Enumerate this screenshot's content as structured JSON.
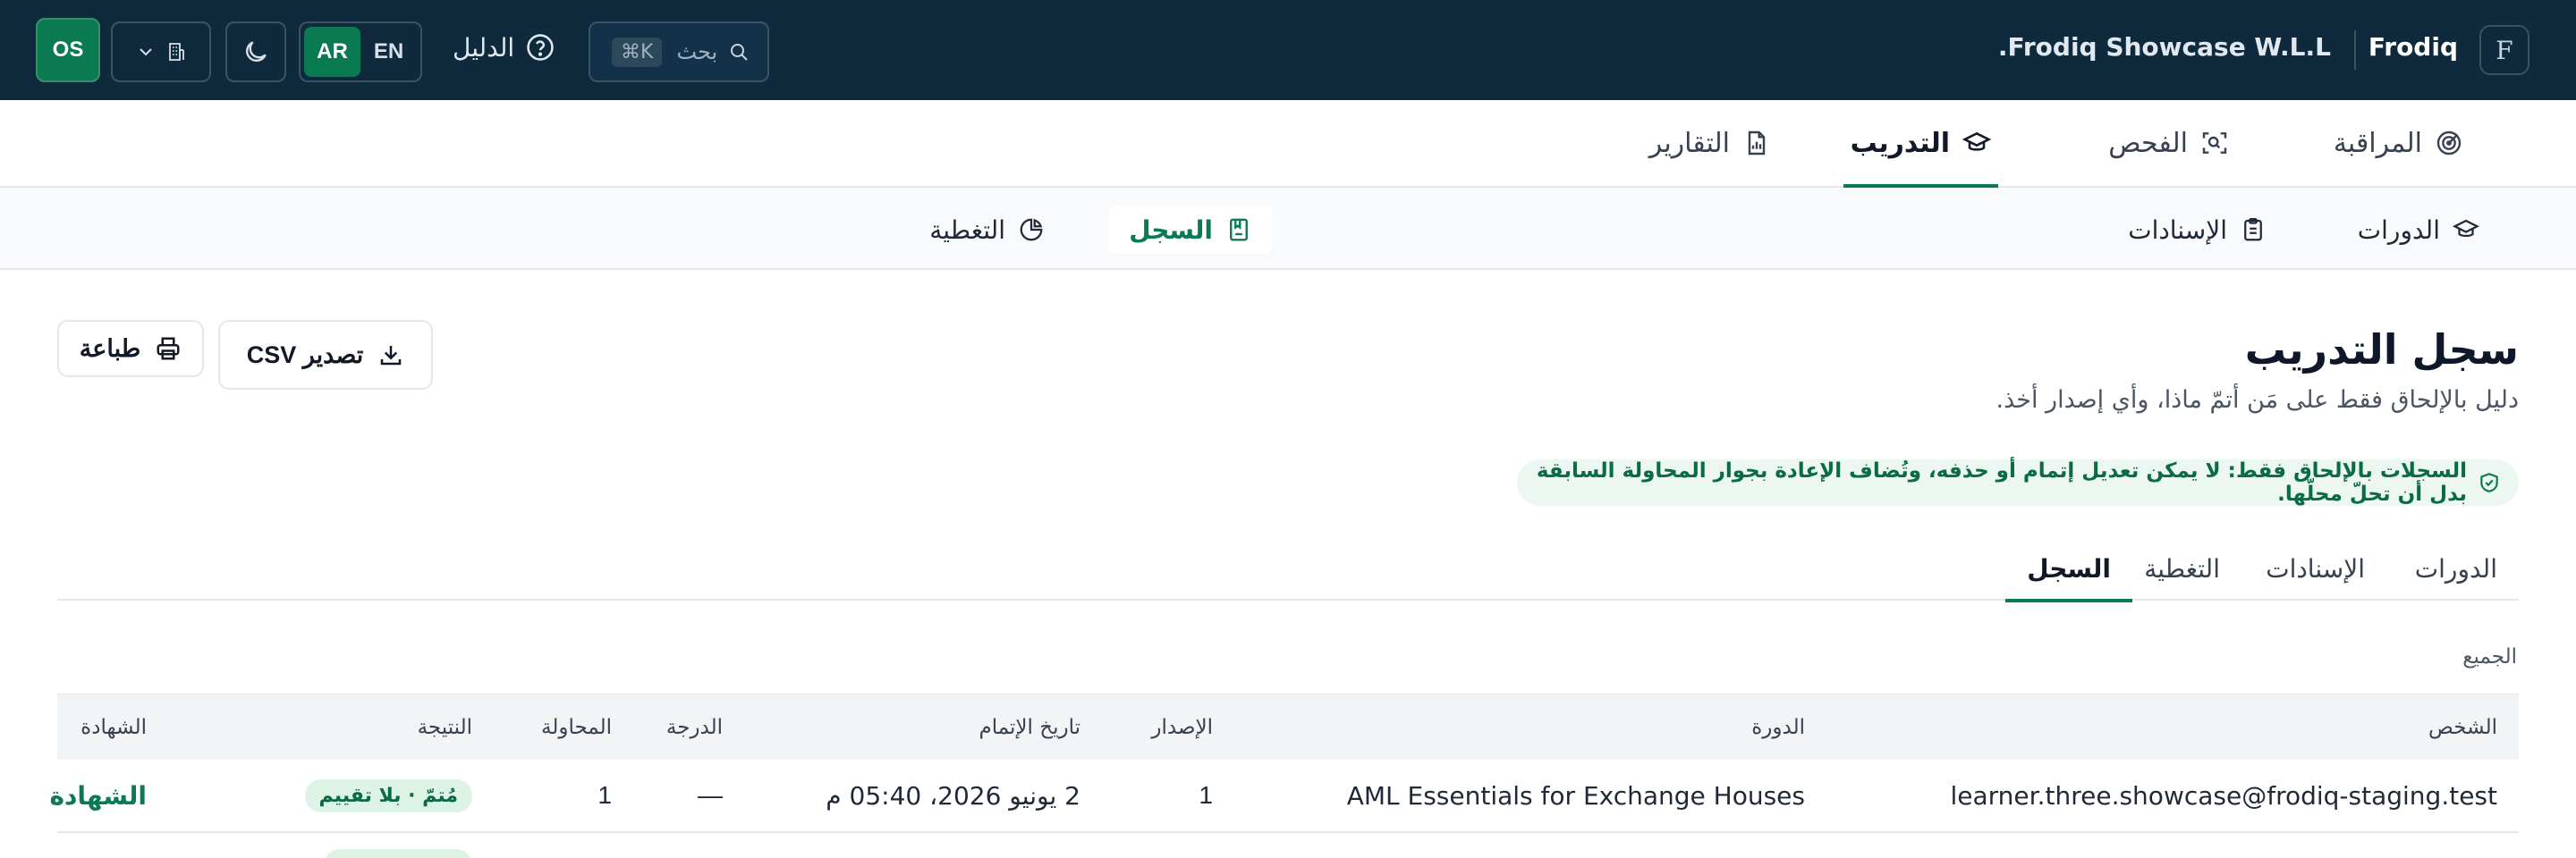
{
  "topbar": {
    "brand_letter": "F",
    "brand_name": "Frodiq",
    "org_name": "Frodiq Showcase W.L.L.",
    "search_placeholder": "بحث",
    "search_shortcut": "⌘K",
    "guide_label": "الدليل",
    "lang_ar": "AR",
    "lang_en": "EN",
    "avatar_initials": "OS"
  },
  "main_nav": [
    {
      "label": "المراقبة",
      "icon": "radar-icon"
    },
    {
      "label": "الفحص",
      "icon": "scan-icon"
    },
    {
      "label": "التدريب",
      "icon": "graduation-cap-icon",
      "active": true
    },
    {
      "label": "التقارير",
      "icon": "report-icon"
    }
  ],
  "sub_nav": [
    {
      "label": "الدورات",
      "icon": "graduation-cap-icon"
    },
    {
      "label": "الإسنادات",
      "icon": "clipboard-icon"
    },
    {
      "label": "السجل",
      "icon": "record-book-icon",
      "active": true
    },
    {
      "label": "التغطية",
      "icon": "pie-chart-icon"
    }
  ],
  "page": {
    "title": "سجل التدريب",
    "subtitle": "دليل بالإلحاق فقط على مَن أتمّ ماذا، وأي إصدار أخذ.",
    "export_button": "تصدير CSV",
    "print_button": "طباعة",
    "notice": "السجلات بالإلحاق فقط: لا يمكن تعديل إتمام أو حذفه، وتُضاف الإعادة بجوار المحاولة السابقة بدل أن تحلّ محلّها."
  },
  "content_tabs": [
    {
      "label": "الدورات"
    },
    {
      "label": "الإسنادات"
    },
    {
      "label": "التغطية"
    },
    {
      "label": "السجل",
      "active": true
    }
  ],
  "filter_label": "الجميع",
  "table": {
    "columns": {
      "person": "الشخص",
      "course": "الدورة",
      "version": "الإصدار",
      "completed_at": "تاريخ الإتمام",
      "score": "الدرجة",
      "attempt": "المحاولة",
      "result": "النتيجة",
      "certificate": "الشهادة"
    },
    "rows": [
      {
        "person": "learner.three.showcase@frodiq-staging.test",
        "course": "AML Essentials for Exchange Houses",
        "version": "1",
        "completed_at": "2 يونيو 2026، 05:40 م",
        "score": "—",
        "attempt": "1",
        "result": "مُتمّ · بلا تقييم",
        "certificate": "الشهادة"
      }
    ]
  },
  "colors": {
    "topbar_bg": "#0f2a3d",
    "accent": "#0a7a52",
    "notice_bg": "#ecf7f1"
  }
}
